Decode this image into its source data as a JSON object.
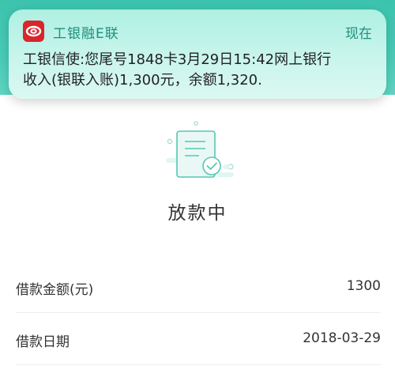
{
  "notification": {
    "app_name": "工银融E联",
    "time": "现在",
    "line1": "工银信使:您尾号1848卡3月29日15:42网上银行",
    "line2": "收入(银联入账)1,300元，余额1,320.",
    "icon": "icbc-logo-icon"
  },
  "status": {
    "icon": "document-check-icon",
    "title": "放款中"
  },
  "details": [
    {
      "label": "借款金额(元)",
      "value": "1300"
    },
    {
      "label": "借款日期",
      "value": "2018-03-29"
    }
  ],
  "colors": {
    "brand_teal": "#3cc3ae",
    "notification_bg": "#c9f5ec",
    "app_icon_red": "#d9262c",
    "app_name_text": "#1f8f7c"
  }
}
